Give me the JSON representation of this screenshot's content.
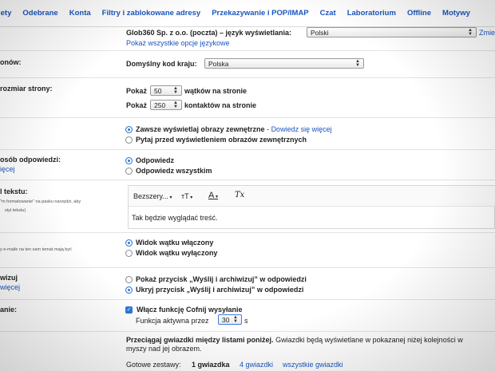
{
  "tabs": [
    "iety",
    "Odebrane",
    "Konta",
    "Filtry i zablokowane adresy",
    "Przekazywanie i POP/IMAP",
    "Czat",
    "Laboratorium",
    "Offline",
    "Motywy"
  ],
  "language": {
    "text": "Glob360 Sp. z o.o. (poczta) – język wyświetlania:",
    "selected": "Polski",
    "change_link": "Zmie",
    "all_options_link": "Pokaż wszystkie opcje językowe"
  },
  "phones": {
    "label": "onów:",
    "text": "Domyślny kod kraju:",
    "selected": "Polska"
  },
  "page_size": {
    "label": "rozmiar strony:",
    "show1": "Pokaż",
    "threads_value": "50",
    "threads_text": "wątków na stronie",
    "show2": "Pokaż",
    "contacts_value": "250",
    "contacts_text": "kontaktów na stronie"
  },
  "images": {
    "option1": "Zawsze wyświetlaj obrazy zewnętrzne",
    "option1_sep": " - ",
    "learn_more": "Dowiedz się więcej",
    "option2": "Pytaj przed wyświetleniem obrazów zewnętrznych"
  },
  "reply": {
    "label": "osób odpowiedzi:",
    "link": "ięcej",
    "option1": "Odpowiedz",
    "option2": "Odpowiedz wszystkim"
  },
  "text_style": {
    "label": "l tekstu:",
    "sub1": "\"m formatowanie\" na pasku narzędzi, aby",
    "sub2": "styl tekstu)",
    "font": "Bezszery...",
    "size_icon": "тT",
    "color_icon": "A",
    "clear_icon": "Tx",
    "preview": "Tak będzie wyglądać treść."
  },
  "conversation": {
    "sub": "y e-maile na ten sam temat mają być",
    "option1": "Widok wątku włączony",
    "option2": "Widok wątku wyłączony"
  },
  "send_archive": {
    "label": "wizuj",
    "link": "więcej",
    "option1": "Pokaż przycisk „Wyślij i archiwizuj” w odpowiedzi",
    "option2": "Ukryj przycisk „Wyślij i archiwizuj” w odpowiedzi"
  },
  "undo_send": {
    "label": "anie:",
    "checkbox": "Włącz funkcję Cofnij wysyłanie",
    "period_text": "Funkcja aktywna przez",
    "value": "30",
    "unit": "s"
  },
  "stars": {
    "desc_bold": "Przeciągaj gwiazdki między listami poniżej.",
    "desc_rest": "Gwiazdki będą wyświetlane w pokazanej niżej kolejności w",
    "desc_line2": "myszy nad jej obrazem.",
    "presets_label": "Gotowe zestawy:",
    "preset1": "1 gwiazdka",
    "preset2": "4 gwiazdki",
    "preset3": "wszystkie gwiazdki"
  }
}
